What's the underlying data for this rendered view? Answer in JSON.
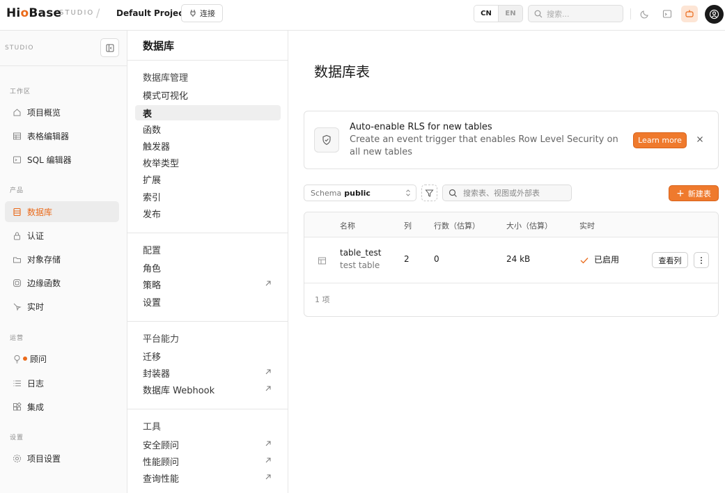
{
  "topbar": {
    "brand_prefix": "Hi",
    "brand_o": "o",
    "brand_suffix": "Base",
    "studio": "STUDIO",
    "separator": "/",
    "project": "Default Project",
    "connect_label": "连接",
    "lang_cn": "CN",
    "lang_en": "EN",
    "search_placeholder": "搜索..."
  },
  "sidebar": {
    "studio_label": "STUDIO",
    "sections": {
      "workspace": "工作区",
      "product": "产品",
      "ops": "运营",
      "settings": "设置"
    },
    "items": [
      {
        "label": "项目概览",
        "icon": "home-icon"
      },
      {
        "label": "表格编辑器",
        "icon": "table-icon"
      },
      {
        "label": "SQL 编辑器",
        "icon": "terminal-icon"
      },
      {
        "label": "数据库",
        "icon": "database-icon",
        "active": true
      },
      {
        "label": "认证",
        "icon": "lock-icon"
      },
      {
        "label": "对象存储",
        "icon": "storage-icon"
      },
      {
        "label": "边缘函数",
        "icon": "function-icon"
      },
      {
        "label": "实时",
        "icon": "realtime-icon"
      },
      {
        "label": "顾问",
        "icon": "lightbulb-icon"
      },
      {
        "label": "日志",
        "icon": "list-icon"
      },
      {
        "label": "集成",
        "icon": "integrations-icon"
      },
      {
        "label": "项目设置",
        "icon": "gear-icon"
      }
    ]
  },
  "panel": {
    "title": "数据库",
    "group_manage": "数据库管理",
    "manage_items": [
      "模式可视化",
      "表",
      "函数",
      "触发器",
      "枚举类型",
      "扩展",
      "索引",
      "发布"
    ],
    "group_config": "配置",
    "config_items": [
      "角色",
      "策略",
      "设置"
    ],
    "group_platform": "平台能力",
    "platform_items": [
      "迁移",
      "封装器",
      "数据库 Webhook"
    ],
    "group_tools": "工具",
    "tool_items": [
      "安全顾问",
      "性能顾问",
      "查询性能"
    ]
  },
  "main": {
    "title": "数据库表",
    "banner": {
      "title": "Auto-enable RLS for new tables",
      "desc": "Create an event trigger that enables Row Level Security on all new tables",
      "learn_more": "Learn more"
    },
    "schema_label": "Schema",
    "schema_value": "public",
    "search_placeholder": "搜索表、视图或外部表",
    "new_table_label": "新建表",
    "table": {
      "headers": [
        "名称",
        "列",
        "行数（估算）",
        "大小（估算）",
        "实时"
      ],
      "rows": [
        {
          "name": "table_test",
          "desc": "test table",
          "cols": "2",
          "rows": "0",
          "size": "24 kB",
          "realtime": "已启用",
          "action": "查看列"
        }
      ],
      "count": "1 项"
    }
  },
  "colors": {
    "accent": "#ea6a1a",
    "button": "#ef7a2d"
  }
}
